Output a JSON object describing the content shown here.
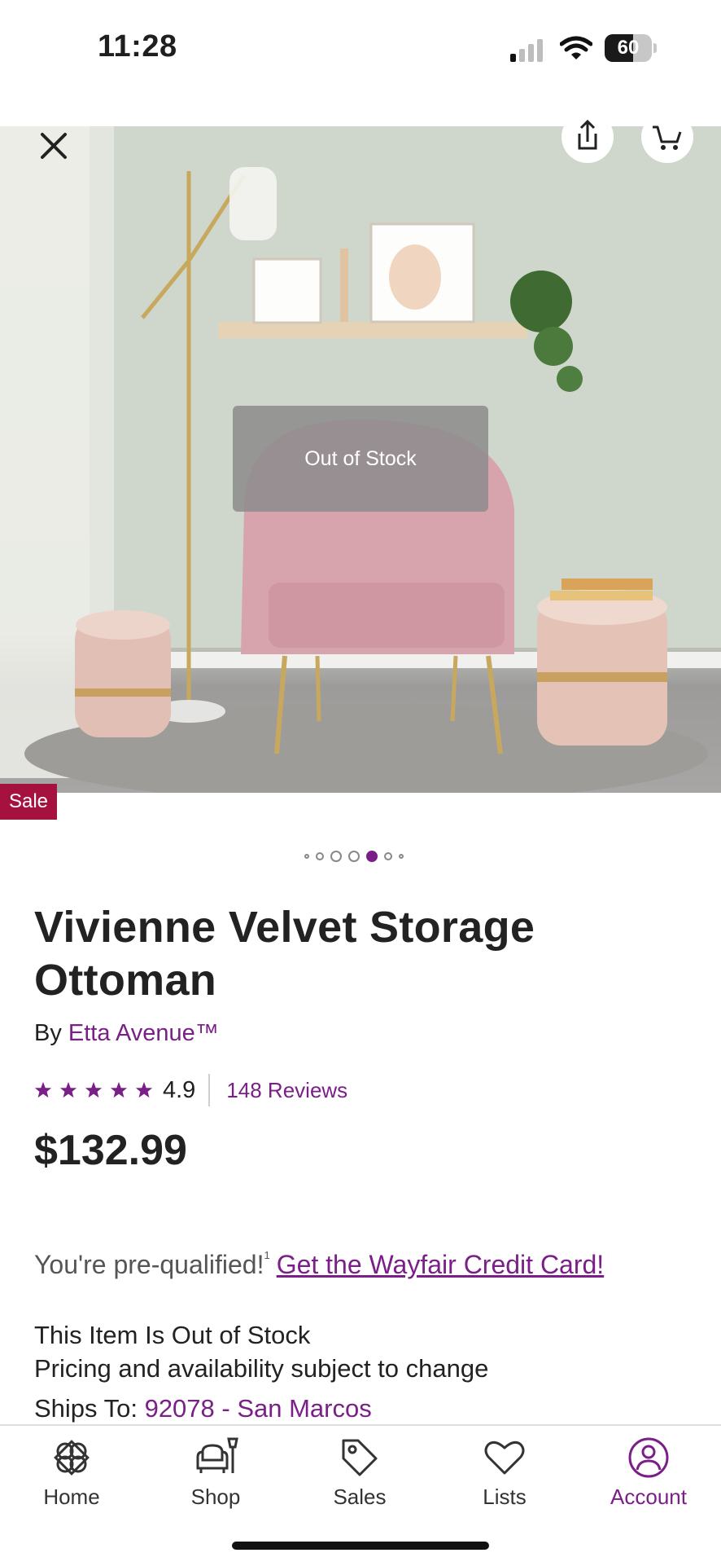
{
  "status": {
    "time": "11:28",
    "battery": "60",
    "battery_level": 0.6
  },
  "product": {
    "out_of_stock_overlay": "Out of Stock",
    "sale_badge": "Sale",
    "image_count": 7,
    "active_image": 4,
    "title": "Vivienne Velvet Storage Ottoman",
    "by_label": "By",
    "brand": "Etta Avenue™",
    "rating": "4.9",
    "rating_stars": 5,
    "reviews": "148 Reviews",
    "price": "$132.99",
    "prequal_text": "You're pre-qualified!",
    "prequal_sup": "1",
    "credit_link": "Get the Wayfair Credit Card!",
    "stock_status": "This Item Is Out of Stock",
    "pricing_note": "Pricing and availability subject to change",
    "ships_label": "Ships To:",
    "ships_location": "92078 - San Marcos"
  },
  "colors": {
    "accent": "#7b1f88",
    "sale": "#a5123f"
  },
  "tabs": [
    {
      "label": "Home",
      "icon": "home-icon"
    },
    {
      "label": "Shop",
      "icon": "shop-icon"
    },
    {
      "label": "Sales",
      "icon": "sales-tag-icon"
    },
    {
      "label": "Lists",
      "icon": "heart-icon"
    },
    {
      "label": "Account",
      "icon": "account-icon",
      "active": true
    }
  ]
}
